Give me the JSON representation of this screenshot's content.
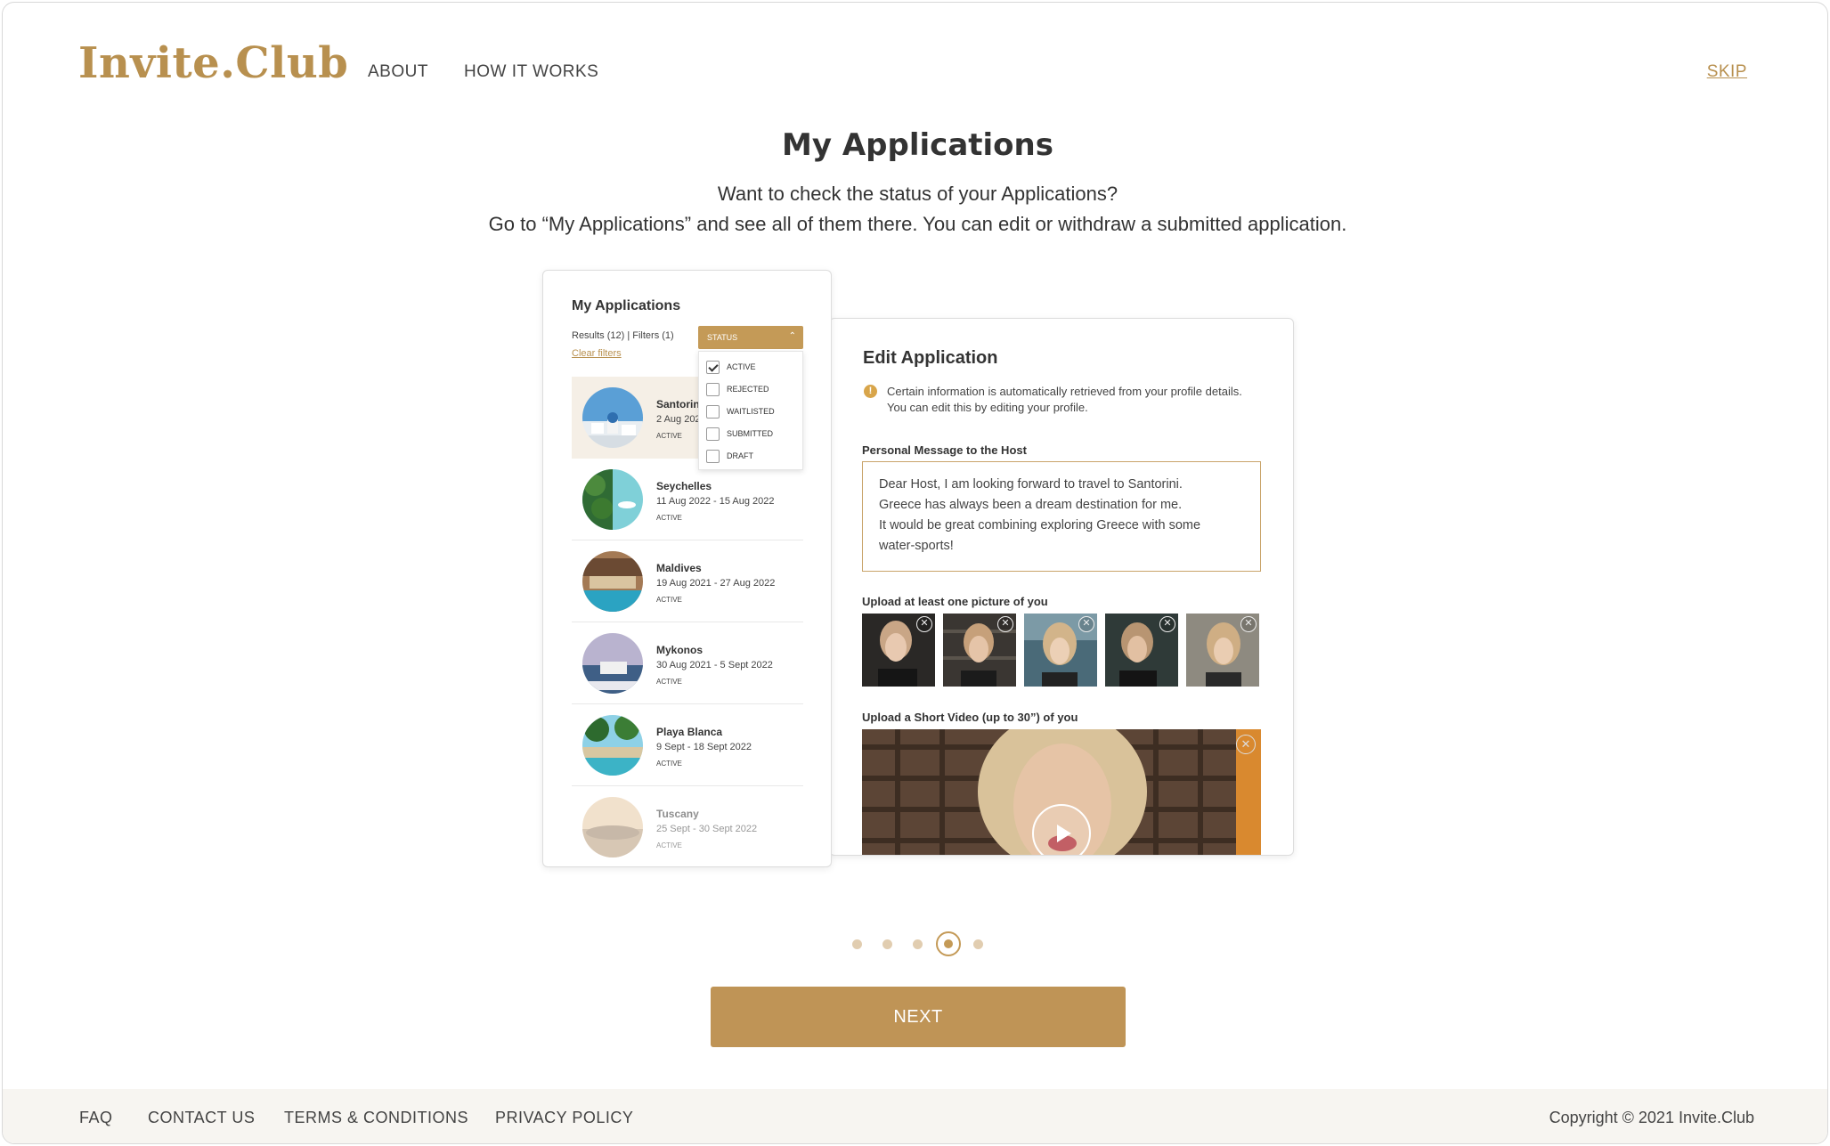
{
  "header": {
    "logo": "Invite.Club",
    "nav": [
      "ABOUT",
      "HOW IT WORKS"
    ],
    "skip": "SKIP"
  },
  "main": {
    "title": "My Applications",
    "subtitle_1": "Want to check the status of your Applications?",
    "subtitle_2": "Go to “My Applications” and see all of them there. You can edit or withdraw a submitted application."
  },
  "applications_panel": {
    "title": "My Applications",
    "results": "Results (12) | Filters (1)",
    "clear_filters": "Clear filters",
    "status_label": "STATUS",
    "status_options": [
      {
        "label": "ACTIVE",
        "checked": true
      },
      {
        "label": "REJECTED",
        "checked": false
      },
      {
        "label": "WAITLISTED",
        "checked": false
      },
      {
        "label": "SUBMITTED",
        "checked": false
      },
      {
        "label": "DRAFT",
        "checked": false
      }
    ],
    "items": [
      {
        "name": "Santorini",
        "dates": "2 Aug 2022",
        "status": "ACTIVE"
      },
      {
        "name": "Seychelles",
        "dates": "11 Aug 2022 - 15 Aug 2022",
        "status": "ACTIVE"
      },
      {
        "name": "Maldives",
        "dates": "19 Aug 2021 - 27 Aug 2022",
        "status": "ACTIVE"
      },
      {
        "name": "Mykonos",
        "dates": "30 Aug 2021 - 5 Sept 2022",
        "status": "ACTIVE"
      },
      {
        "name": "Playa Blanca",
        "dates": "9 Sept - 18 Sept 2022",
        "status": "ACTIVE"
      },
      {
        "name": "Tuscany",
        "dates": "25 Sept - 30 Sept 2022",
        "status": "ACTIVE"
      }
    ]
  },
  "edit_panel": {
    "title": "Edit Application",
    "info_line_1": "Certain information is automatically retrieved from your profile details.",
    "info_line_2": "You can edit this by editing your profile.",
    "message_label": "Personal Message to the Host",
    "message_lines": [
      "Dear Host, I am looking forward to travel to Santorini.",
      "Greece has always been a dream destination for me.",
      "It would be great combining exploring Greece with some",
      "water-sports!"
    ],
    "upload_photo_label": "Upload at least one picture of you",
    "upload_video_label": "Upload a Short Video (up to 30”) of you"
  },
  "pagination": {
    "total": 5,
    "active": 4
  },
  "next_button": "NEXT",
  "footer": {
    "links": [
      "FAQ",
      "CONTACT US",
      "TERMS & CONDITIONS",
      "PRIVACY POLICY"
    ],
    "copyright": "Copyright © 2021 Invite.Club"
  },
  "colors": {
    "accent": "#b8904f",
    "button": "#bf9456",
    "footer_bg": "#f7f5f1"
  }
}
